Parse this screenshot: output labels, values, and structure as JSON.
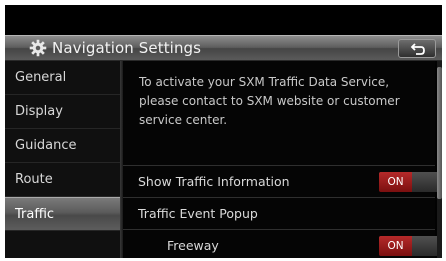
{
  "header": {
    "title": "Navigation Settings",
    "icon": "gear-icon",
    "back_icon": "back-arrow-icon"
  },
  "sidebar": {
    "items": [
      {
        "label": "General",
        "active": false
      },
      {
        "label": "Display",
        "active": false
      },
      {
        "label": "Guidance",
        "active": false
      },
      {
        "label": "Route",
        "active": false
      },
      {
        "label": "Traffic",
        "active": true
      }
    ]
  },
  "content": {
    "info": "To activate your SXM Traffic Data Service, please contact to SXM website or customer service center.",
    "rows": [
      {
        "label": "Show Traffic Information",
        "toggle": "ON"
      },
      {
        "label": "Traffic Event Popup"
      },
      {
        "label": "Freeway",
        "toggle": "ON"
      }
    ]
  },
  "colors": {
    "toggle_on": "#a51e1e",
    "title_bar": "#6a6a6a",
    "background": "#000000"
  }
}
